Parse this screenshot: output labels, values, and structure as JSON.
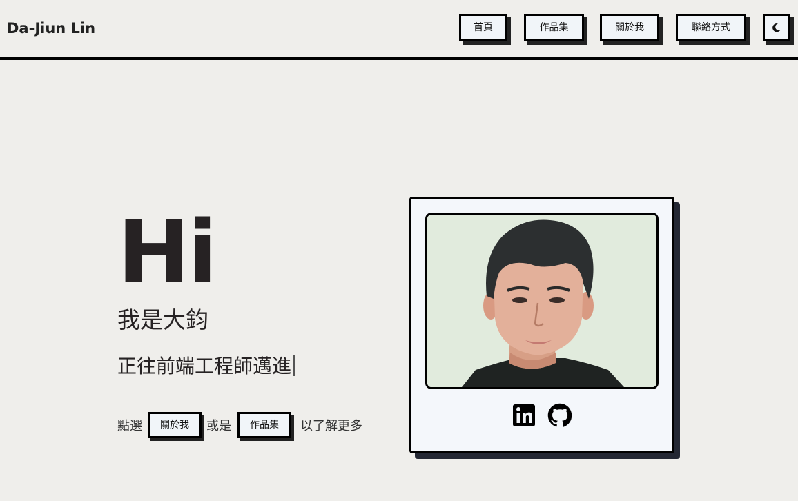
{
  "header": {
    "brand": "Da-Jiun Lin",
    "nav": {
      "home": "首頁",
      "works": "作品集",
      "about": "關於我",
      "contact": "聯絡方式"
    },
    "theme_toggle_icon": "moon-icon"
  },
  "hero": {
    "greeting": "Hi",
    "intro": "我是大鈞",
    "role": "正往前端工程師邁進",
    "cta": {
      "prefix": "點選",
      "about_button": "關於我",
      "middle": "或是",
      "works_button": "作品集",
      "suffix": "以了解更多"
    }
  },
  "profile_card": {
    "photo_icon": "profile-photo",
    "social": [
      "linkedin-icon",
      "github-icon"
    ]
  },
  "colors": {
    "background": "#efeeeb",
    "button_bg": "#f1f5f9",
    "border": "#000000",
    "card_shadow": "#232733",
    "photo_bg": "#e1ebdd"
  }
}
